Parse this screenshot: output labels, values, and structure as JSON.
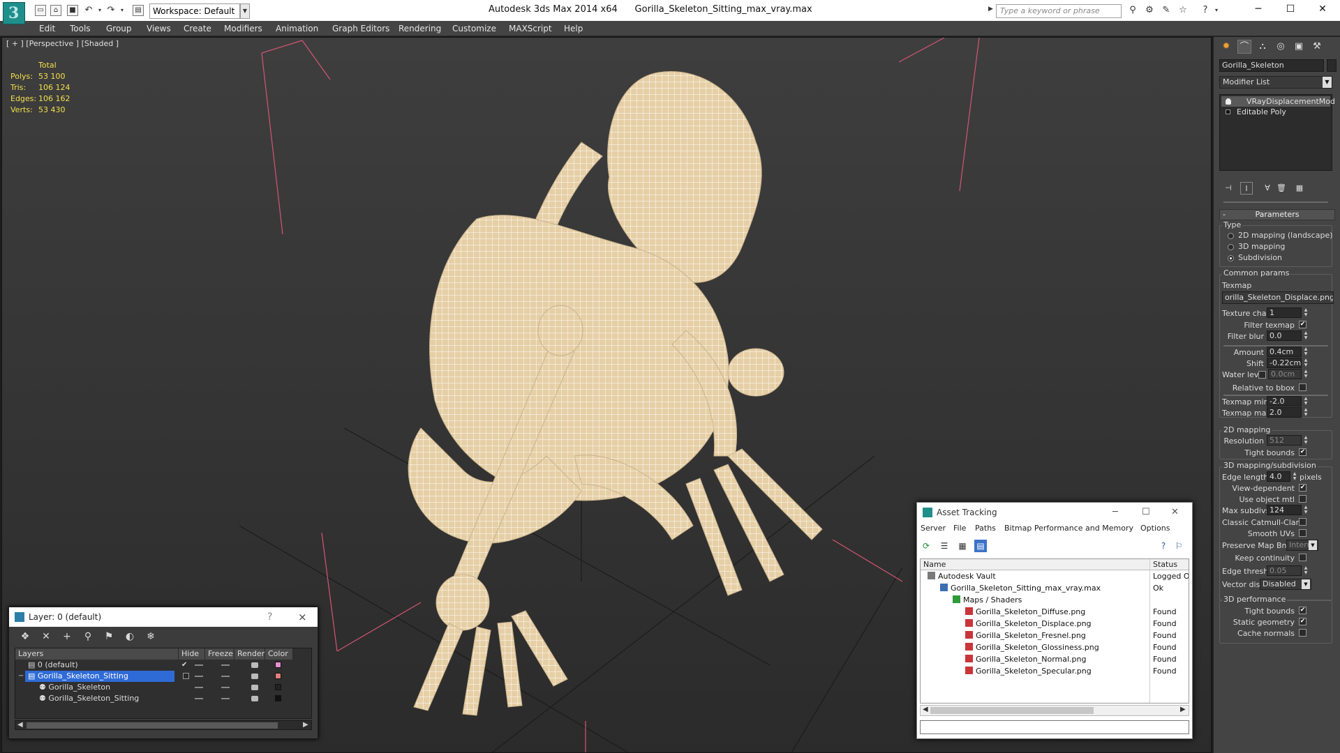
{
  "titlebar": {
    "workspace": "Workspace: Default",
    "title": "Autodesk 3ds Max 2014 x64      Gorilla_Skeleton_Sitting_max_vray.max",
    "search_placeholder": "Type a keyword or phrase",
    "logo_letter": "3"
  },
  "menu": [
    "Edit",
    "Tools",
    "Group",
    "Views",
    "Create",
    "Modifiers",
    "Animation",
    "Graph Editors",
    "Rendering",
    "Customize",
    "MAXScript",
    "Help"
  ],
  "viewport": {
    "label": "[ + ] [Perspective ] [Shaded ]",
    "stats": {
      "header": "Total",
      "rows": [
        {
          "k": "Polys:",
          "v": "53 100"
        },
        {
          "k": "Tris:",
          "v": "106 124"
        },
        {
          "k": "Edges:",
          "v": "106 162"
        },
        {
          "k": "Verts:",
          "v": "53 430"
        }
      ]
    }
  },
  "layer_dialog": {
    "title": "Layer: 0 (default)",
    "help": "?",
    "close": "×",
    "headers": [
      "Layers",
      "Hide",
      "Freeze",
      "Render",
      "Color"
    ],
    "rows": [
      {
        "name": "0 (default)",
        "color": "#e78fd0",
        "check": "✔"
      },
      {
        "name": "Gorilla_Skeleton_Sitting",
        "color": "#e47e7e",
        "selected": true
      },
      {
        "name": "Gorilla_Skeleton",
        "color": "#222222"
      },
      {
        "name": "Gorilla_Skeleton_Sitting",
        "color": "#111111"
      }
    ]
  },
  "asset_tracking": {
    "title": "Asset Tracking",
    "menu": [
      "Server",
      "File",
      "Paths",
      "Bitmap Performance and Memory",
      "Options"
    ],
    "headers": [
      "Name",
      "Status"
    ],
    "rows": [
      {
        "name": "Autodesk Vault",
        "status": "Logged Ou"
      },
      {
        "name": "Gorilla_Skeleton_Sitting_max_vray.max",
        "status": "Ok"
      },
      {
        "name": "Maps / Shaders",
        "status": ""
      },
      {
        "name": "Gorilla_Skeleton_Diffuse.png",
        "status": "Found"
      },
      {
        "name": "Gorilla_Skeleton_Displace.png",
        "status": "Found"
      },
      {
        "name": "Gorilla_Skeleton_Fresnel.png",
        "status": "Found"
      },
      {
        "name": "Gorilla_Skeleton_Glossiness.png",
        "status": "Found"
      },
      {
        "name": "Gorilla_Skeleton_Normal.png",
        "status": "Found"
      },
      {
        "name": "Gorilla_Skeleton_Specular.png",
        "status": "Found"
      }
    ]
  },
  "command_panel": {
    "object_name": "Gorilla_Skeleton",
    "modifier_list": "Modifier List",
    "stack": [
      "VRayDisplacementMod",
      "Editable Poly"
    ],
    "rollout": "Parameters",
    "type_label": "Type",
    "type_options": [
      "2D mapping (landscape)",
      "3D mapping",
      "Subdivision"
    ],
    "common_params": "Common params",
    "texmap_label": "Texmap",
    "texmap_value": "orilla_Skeleton_Displace.png)",
    "texture_chan_label": "Texture chan",
    "texture_chan": "1",
    "filter_texmap": "Filter texmap",
    "filter_blur_label": "Filter blur",
    "filter_blur": "0.0",
    "amount_label": "Amount",
    "amount": "0.4cm",
    "shift_label": "Shift",
    "shift": "-0.22cm",
    "water_level_label": "Water level",
    "water_level": "0.0cm",
    "relative_bbox": "Relative to bbox",
    "texmap_min_label": "Texmap min",
    "texmap_min": "-2.0",
    "texmap_max_label": "Texmap max",
    "texmap_max": "2.0",
    "mapping2d": "2D mapping",
    "resolution_label": "Resolution",
    "resolution": "512",
    "tight_bounds": "Tight bounds",
    "mapping3d": "3D mapping/subdivision",
    "edge_length_label": "Edge length",
    "edge_length": "4.0",
    "pixels": "pixels",
    "view_dependent": "View-dependent",
    "use_object_mtl": "Use object mtl",
    "max_subdivs_label": "Max subdivs",
    "max_subdivs": "124",
    "classic_catmull": "Classic Catmull-Clark",
    "smooth_uvs": "Smooth UVs",
    "preserve_map_bnd": "Preserve Map Bnd",
    "preserve_map_bnd_value": "Intern",
    "keep_continuity": "Keep continuity",
    "edge_thresh_label": "Edge thresh",
    "edge_thresh": "0.05",
    "vector_displ_label": "Vector displ",
    "vector_displ": "Disabled",
    "performance": "3D performance",
    "perf_tight_bounds": "Tight bounds",
    "static_geometry": "Static geometry",
    "cache_normals": "Cache normals"
  },
  "colors": {
    "viewport_bg": "#353535",
    "selection": "#2f6bd6",
    "stats_text": "#f2e04a",
    "bone": "#e8d2ad",
    "panel_bg": "#444444"
  }
}
